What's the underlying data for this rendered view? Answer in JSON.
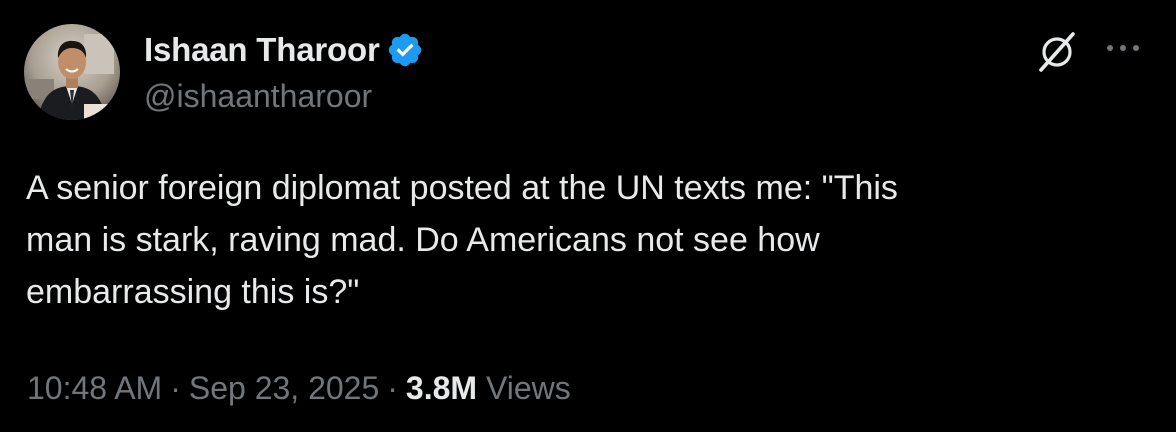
{
  "author": {
    "display_name": "Ishaan Tharoor",
    "handle": "@ishaantharoor",
    "verified": true,
    "verified_color": "#1d9bf0",
    "avatar_icon": "profile-photo"
  },
  "actions": {
    "grok_icon": "grok-icon",
    "more_icon": "more-options-icon"
  },
  "tweet": {
    "text": "A senior foreign diplomat posted at the UN texts me: \"This\nman is stark, raving mad. Do Americans not see how\nembarrassing this is?\""
  },
  "meta": {
    "time": "10:48 AM",
    "separator": "·",
    "date": "Sep 23, 2025",
    "views_count": "3.8M",
    "views_label": "Views"
  },
  "colors": {
    "background": "#000000",
    "primary_text": "#e7e9ea",
    "secondary_text": "#71767b"
  }
}
